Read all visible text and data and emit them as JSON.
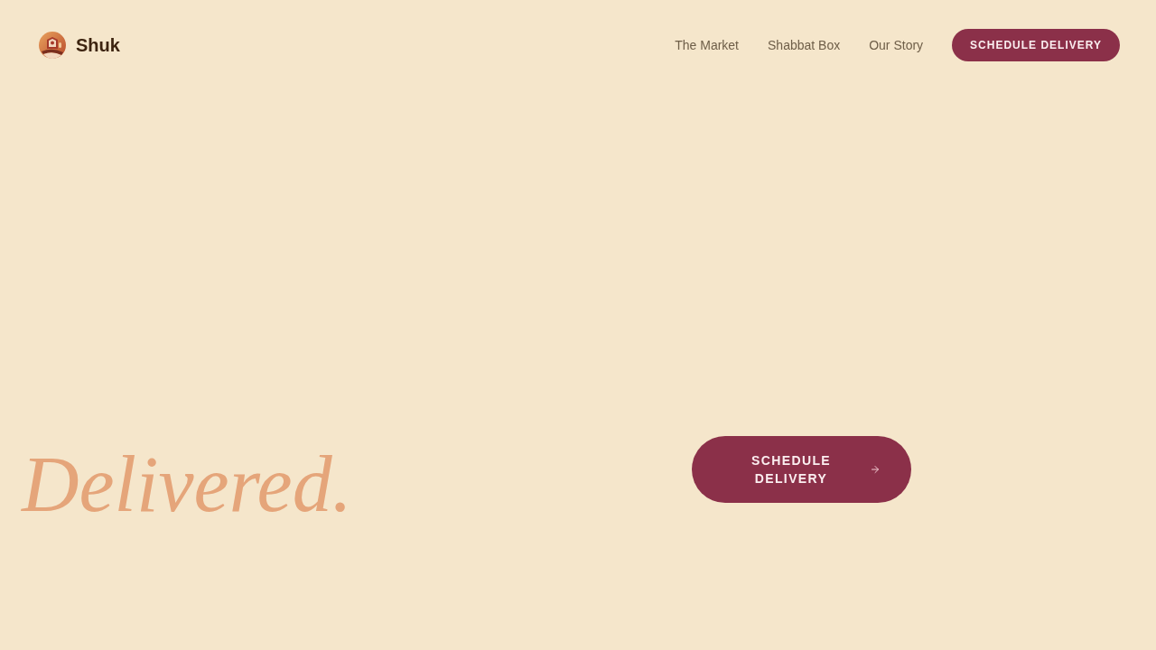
{
  "header": {
    "brand": "Shuk",
    "nav": [
      {
        "label": "The Market"
      },
      {
        "label": "Shabbat Box"
      },
      {
        "label": "Our Story"
      }
    ],
    "cta": "SCHEDULE DELIVERY"
  },
  "hero": {
    "headline": "Delivered.",
    "cta": "SCHEDULE DELIVERY"
  }
}
